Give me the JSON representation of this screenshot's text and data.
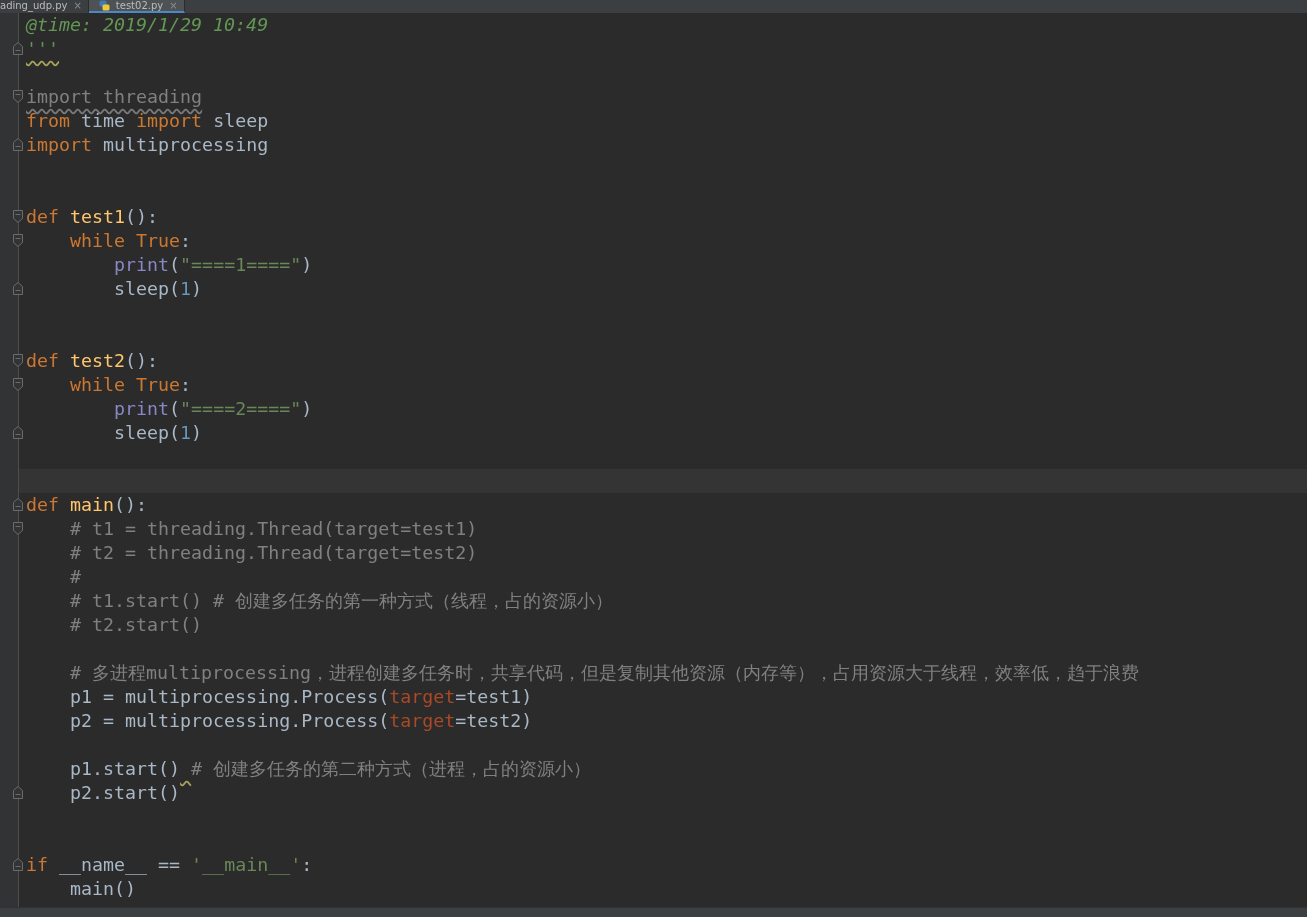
{
  "tabs": [
    {
      "label": "ading_udp.py",
      "close": "×",
      "selected": false,
      "show_icon": false
    },
    {
      "label": "test02.py",
      "close": "×",
      "selected": true,
      "show_icon": true
    }
  ],
  "lines": [
    {
      "kind": "code",
      "tokens": [
        {
          "kind": "docstring",
          "text": "@time: 2019/1/29 10:49"
        }
      ]
    },
    {
      "kind": "code",
      "fold": {
        "kind": "end"
      },
      "tokens": [
        {
          "kind": "docstring",
          "text": "'''",
          "squiggle": {
            "kind": "whole"
          }
        }
      ]
    },
    {
      "kind": "blank"
    },
    {
      "kind": "code",
      "fold": {
        "kind": "start"
      },
      "tokens": [
        {
          "kind": "unused",
          "text": "import threading"
        }
      ]
    },
    {
      "kind": "code",
      "tokens": [
        {
          "kind": "keyword",
          "text": "from"
        },
        {
          "kind": "plain",
          "text": " time "
        },
        {
          "kind": "keyword",
          "text": "import"
        },
        {
          "kind": "plain",
          "text": " sleep"
        }
      ]
    },
    {
      "kind": "code",
      "fold": {
        "kind": "end"
      },
      "tokens": [
        {
          "kind": "keyword",
          "text": "import"
        },
        {
          "kind": "plain",
          "text": " multiprocessing"
        }
      ]
    },
    {
      "kind": "blank"
    },
    {
      "kind": "blank"
    },
    {
      "kind": "code",
      "fold": {
        "kind": "start"
      },
      "tokens": [
        {
          "kind": "keyword",
          "text": "def "
        },
        {
          "kind": "func",
          "text": "test1"
        },
        {
          "kind": "plain",
          "text": "():"
        }
      ]
    },
    {
      "kind": "code",
      "fold": {
        "kind": "start"
      },
      "tokens": [
        {
          "kind": "keyword",
          "text": "    while True"
        },
        {
          "kind": "plain",
          "text": ":"
        }
      ]
    },
    {
      "kind": "code",
      "tokens": [
        {
          "kind": "builtin",
          "text": "        print"
        },
        {
          "kind": "plain",
          "text": "("
        },
        {
          "kind": "string",
          "text": "\"====1====\""
        },
        {
          "kind": "plain",
          "text": ")"
        }
      ]
    },
    {
      "kind": "code",
      "fold": {
        "kind": "end"
      },
      "tokens": [
        {
          "kind": "plain",
          "text": "        sleep("
        },
        {
          "kind": "number",
          "text": "1"
        },
        {
          "kind": "plain",
          "text": ")"
        }
      ]
    },
    {
      "kind": "blank"
    },
    {
      "kind": "blank"
    },
    {
      "kind": "code",
      "fold": {
        "kind": "start"
      },
      "tokens": [
        {
          "kind": "keyword",
          "text": "def "
        },
        {
          "kind": "func",
          "text": "test2"
        },
        {
          "kind": "plain",
          "text": "():"
        }
      ]
    },
    {
      "kind": "code",
      "fold": {
        "kind": "start"
      },
      "tokens": [
        {
          "kind": "keyword",
          "text": "    while True"
        },
        {
          "kind": "plain",
          "text": ":"
        }
      ]
    },
    {
      "kind": "code",
      "tokens": [
        {
          "kind": "builtin",
          "text": "        print"
        },
        {
          "kind": "plain",
          "text": "("
        },
        {
          "kind": "string",
          "text": "\"====2====\""
        },
        {
          "kind": "plain",
          "text": ")"
        }
      ]
    },
    {
      "kind": "code",
      "fold": {
        "kind": "end"
      },
      "tokens": [
        {
          "kind": "plain",
          "text": "        sleep("
        },
        {
          "kind": "number",
          "text": "1"
        },
        {
          "kind": "plain",
          "text": ")"
        }
      ]
    },
    {
      "kind": "blank"
    },
    {
      "kind": "blank",
      "current": true
    },
    {
      "kind": "code",
      "fold": {
        "kind": "end"
      },
      "tokens": [
        {
          "kind": "keyword",
          "text": "def "
        },
        {
          "kind": "func",
          "text": "main"
        },
        {
          "kind": "plain",
          "text": "():"
        }
      ]
    },
    {
      "kind": "code",
      "fold": {
        "kind": "start"
      },
      "tokens": [
        {
          "kind": "comment",
          "text": "    # t1 = threading.Thread(target=test1)"
        }
      ]
    },
    {
      "kind": "code",
      "tokens": [
        {
          "kind": "comment",
          "text": "    # t2 = threading.Thread(target=test2)"
        }
      ]
    },
    {
      "kind": "code",
      "tokens": [
        {
          "kind": "comment",
          "text": "    #"
        }
      ]
    },
    {
      "kind": "code",
      "tokens": [
        {
          "kind": "comment",
          "text": "    # t1.start() # 创建多任务的第一种方式（线程，占的资源小）"
        }
      ]
    },
    {
      "kind": "code",
      "tokens": [
        {
          "kind": "comment",
          "text": "    # t2.start()"
        }
      ]
    },
    {
      "kind": "blank"
    },
    {
      "kind": "code",
      "tokens": [
        {
          "kind": "comment",
          "text": "    # 多进程multiprocessing，进程创建多任务时，共享代码，但是复制其他资源（内存等），占用资源大于线程，效率低，趋于浪费"
        }
      ]
    },
    {
      "kind": "code",
      "tokens": [
        {
          "kind": "plain",
          "text": "    p1 = multiprocessing.Process("
        },
        {
          "kind": "kwarg",
          "text": "target"
        },
        {
          "kind": "plain",
          "text": "=test1)"
        }
      ]
    },
    {
      "kind": "code",
      "tokens": [
        {
          "kind": "plain",
          "text": "    p2 = multiprocessing.Process("
        },
        {
          "kind": "kwarg",
          "text": "target"
        },
        {
          "kind": "plain",
          "text": "=test2)"
        }
      ]
    },
    {
      "kind": "blank"
    },
    {
      "kind": "code",
      "tokens": [
        {
          "kind": "plain",
          "text": "    p1.start()"
        },
        {
          "kind": "comment",
          "text": " # 创建多任务的第二种方式（进程，占的资源小）",
          "squiggle": {
            "kind": "lead"
          }
        }
      ]
    },
    {
      "kind": "code",
      "fold": {
        "kind": "end"
      },
      "tokens": [
        {
          "kind": "plain",
          "text": "    p2.start()"
        }
      ]
    },
    {
      "kind": "blank"
    },
    {
      "kind": "blank"
    },
    {
      "kind": "code",
      "fold": {
        "kind": "end"
      },
      "tokens": [
        {
          "kind": "keyword",
          "text": "if"
        },
        {
          "kind": "plain",
          "text": " __name__ == "
        },
        {
          "kind": "string",
          "text": "'__main__'"
        },
        {
          "kind": "plain",
          "text": ":"
        }
      ]
    },
    {
      "kind": "code",
      "tokens": [
        {
          "kind": "plain",
          "text": "    main()"
        }
      ]
    }
  ]
}
